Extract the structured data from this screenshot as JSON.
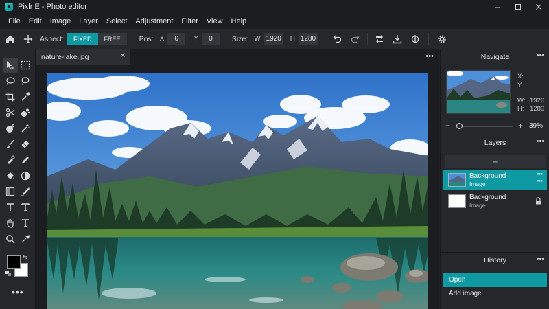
{
  "window": {
    "title": "Pixlr E - Photo editor",
    "controls": [
      "minimize",
      "maximize",
      "close"
    ]
  },
  "menu": [
    "File",
    "Edit",
    "Image",
    "Layer",
    "Select",
    "Adjustment",
    "Filter",
    "View",
    "Help"
  ],
  "options": {
    "aspect_label": "Aspect:",
    "aspect_fixed": "FIXED",
    "aspect_free": "FREE",
    "aspect_selected": "FIXED",
    "pos_label": "Pos:",
    "x_label": "X",
    "x_value": "0",
    "y_label": "Y",
    "y_value": "0",
    "size_label": "Size:",
    "w_label": "W",
    "w_value": "1920",
    "h_label": "H",
    "h_value": "1280"
  },
  "document": {
    "tab_name": "nature-lake.jpg"
  },
  "tools": [
    "arrange-icon",
    "marquee-icon",
    "lasso-icon",
    "quick-select-icon",
    "crop-icon",
    "eyedropper-icon",
    "cutout-icon",
    "liquify-icon",
    "heal-icon",
    "wand-icon",
    "brush-icon",
    "eraser-icon",
    "clone-icon",
    "pencil-icon",
    "fill-icon",
    "dodge-icon",
    "gradient-icon",
    "pen-icon",
    "text-icon",
    "type-icon",
    "hand-icon",
    "text-alt-icon",
    "zoom-icon",
    "sharpen-icon"
  ],
  "colors": {
    "foreground": "#000000",
    "background": "#ffffff",
    "accent": "#0f9aa3"
  },
  "navigate": {
    "title": "Navigate",
    "x_label": "X:",
    "y_label": "Y:",
    "w_label": "W:",
    "w_value": "1920",
    "h_label": "H:",
    "h_value": "1280",
    "zoom": "39%"
  },
  "layers": {
    "title": "Layers",
    "items": [
      {
        "name": "Background",
        "type": "Image",
        "selected": true
      },
      {
        "name": "Background",
        "type": "Image",
        "selected": false,
        "locked": true
      }
    ]
  },
  "history": {
    "title": "History",
    "items": [
      "Open",
      "Add image"
    ],
    "active": "Open"
  }
}
